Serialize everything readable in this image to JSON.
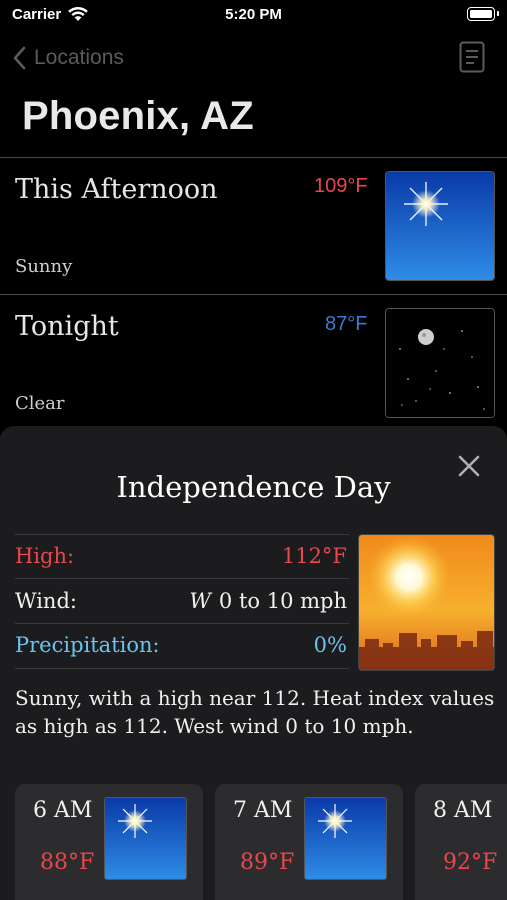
{
  "status_bar": {
    "carrier": "Carrier",
    "time": "5:20 PM"
  },
  "nav": {
    "back_label": "Locations",
    "icons": [
      "chevron-left-icon",
      "document-icon"
    ]
  },
  "page_title": "Phoenix, AZ",
  "forecast": [
    {
      "period": "This Afternoon",
      "temp": "109°F",
      "condition": "Sunny",
      "temp_color": "#e5484d",
      "image": "sunny-sky-image"
    },
    {
      "period": "Tonight",
      "temp": "87°F",
      "condition": "Clear",
      "temp_color": "#3a7bd5",
      "image": "clear-night-sky-image"
    }
  ],
  "detail": {
    "title": "Independence Day",
    "high_label": "High:",
    "high_value": "112°F",
    "wind_label": "Wind:",
    "wind_dir": "W",
    "wind_value": "0 to 10 mph",
    "precip_label": "Precipitation:",
    "precip_value": "0%",
    "description": "Sunny, with a high near 112. Heat index values as high as 112. West wind 0 to 10 mph.",
    "colors": {
      "high": "#e5484d",
      "precip": "#6ac4ee"
    },
    "image": "sunset-city-image"
  },
  "hourly": [
    {
      "time": "6 AM",
      "temp": "88°F"
    },
    {
      "time": "7 AM",
      "temp": "89°F"
    },
    {
      "time": "8 AM",
      "temp": "92°F"
    }
  ]
}
